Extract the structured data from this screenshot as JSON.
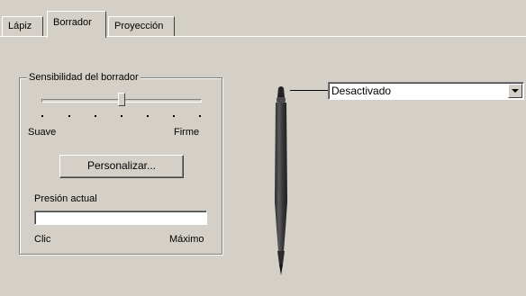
{
  "tabs": [
    {
      "label": "Lápiz",
      "active": false
    },
    {
      "label": "Borrador",
      "active": true
    },
    {
      "label": "Proyección",
      "active": false
    }
  ],
  "eraser_sensitivity": {
    "group_title": "Sensibilidad del borrador",
    "min_label": "Suave",
    "max_label": "Firme",
    "slider_level": 0.5,
    "tick_count": 7,
    "customize_button": "Personalizar..."
  },
  "current_pressure": {
    "label": "Presión actual",
    "min_label": "Clic",
    "max_label": "Máximo",
    "level": 0
  },
  "eraser_function": {
    "selected": "Desactivado"
  },
  "colors": {
    "panel": "#d4d0c8",
    "window": "#ffffff",
    "pen_body": "#3a3a3a"
  },
  "icons": [
    "pen-illustration",
    "dropdown-arrow-icon"
  ]
}
